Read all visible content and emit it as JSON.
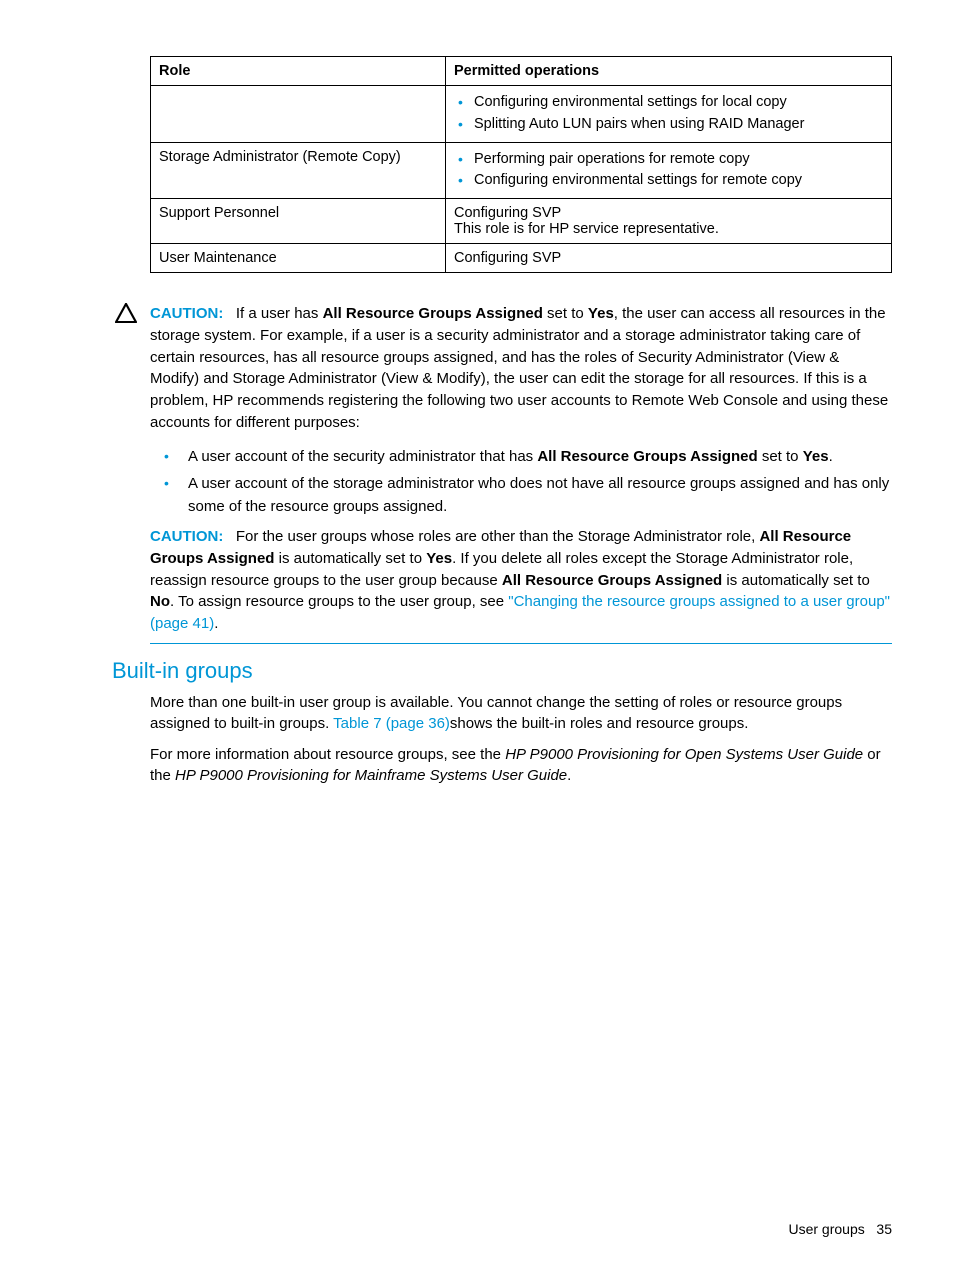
{
  "table": {
    "headers": [
      "Role",
      "Permitted operations"
    ],
    "rows": [
      {
        "role": "",
        "ops_list": [
          "Configuring environmental settings for local copy",
          "Splitting Auto LUN pairs when using RAID Manager"
        ]
      },
      {
        "role": "Storage Administrator (Remote Copy)",
        "ops_list": [
          "Performing pair operations for remote copy",
          "Configuring environmental settings for remote copy"
        ]
      },
      {
        "role": "Support Personnel",
        "ops_text": "Configuring SVP\nThis role is for HP service representative."
      },
      {
        "role": "User Maintenance",
        "ops_text": "Configuring SVP"
      }
    ]
  },
  "caution1": {
    "label": "CAUTION:",
    "pre": "If a user has ",
    "bold1": "All Resource Groups Assigned",
    "mid1": " set to ",
    "bold2": "Yes",
    "post": ", the user can access all resources in the storage system. For example, if a user is a security administrator and a storage administrator taking care of certain resources, has all resource groups assigned, and has the roles of Security Administrator (View & Modify) and Storage Administrator (View & Modify), the user can edit the storage for all resources. If this is a problem, HP recommends registering the following two user accounts to Remote Web Console and using these accounts for different purposes:",
    "bullets": [
      {
        "pre": "A user account of the security administrator that has ",
        "b1": "All Resource Groups Assigned",
        "mid": " set to ",
        "b2": "Yes",
        "post": "."
      },
      {
        "pre": "A user account of the storage administrator who does not have all resource groups assigned and has only some of the resource groups assigned.",
        "b1": "",
        "mid": "",
        "b2": "",
        "post": ""
      }
    ]
  },
  "caution2": {
    "label": "CAUTION:",
    "t1": "For the user groups whose roles are other than the Storage Administrator role, ",
    "b1": "All Resource Groups Assigned",
    "t2": " is automatically set to ",
    "b2": "Yes",
    "t3": ". If you delete all roles except the Storage Administrator role, reassign resource groups to the user group because ",
    "b3": "All Resource Groups Assigned",
    "t4": " is automatically set to ",
    "b4": "No",
    "t5": ". To assign resource groups to the user group, see ",
    "link": "\"Changing the resource groups assigned to a user group\" (page 41)",
    "t6": "."
  },
  "section": {
    "heading": "Built-in groups",
    "p1a": "More than one built-in user group is available. You cannot change the setting of roles or resource groups assigned to built-in groups. ",
    "p1link": "Table 7 (page 36)",
    "p1b": "shows the built-in roles and resource groups.",
    "p2a": "For more information about resource groups, see the ",
    "p2i1": "HP P9000 Provisioning for Open Systems User Guide",
    "p2b": " or the ",
    "p2i2": "HP P9000 Provisioning for Mainframe Systems User Guide",
    "p2c": "."
  },
  "footer": {
    "text": "User groups",
    "page": "35"
  }
}
